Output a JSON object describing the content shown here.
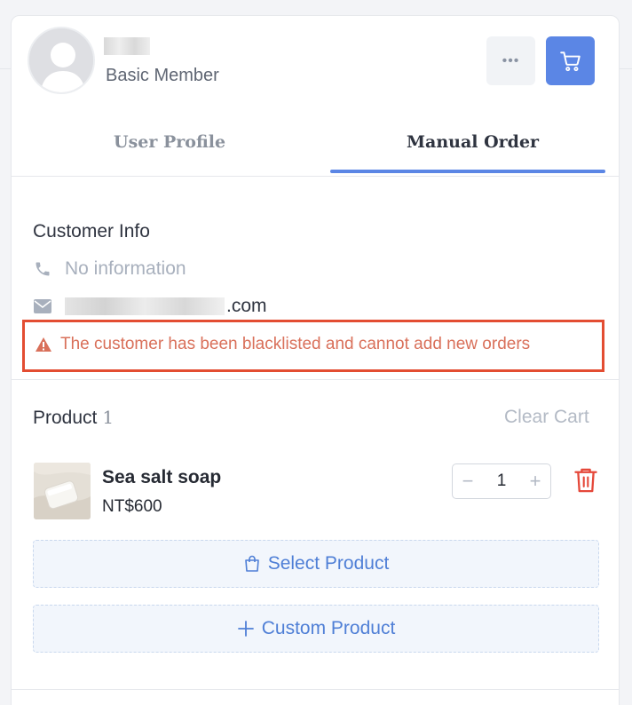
{
  "header": {
    "member_level": "Basic Member",
    "more_label": "•••"
  },
  "tabs": [
    {
      "label": "User Profile",
      "active": false
    },
    {
      "label": "Manual Order",
      "active": true
    }
  ],
  "customer": {
    "title": "Customer Info",
    "phone": "No information",
    "email_suffix": ".com",
    "warning": "The customer has been blacklisted and cannot add new orders"
  },
  "product": {
    "title": "Product",
    "count": "1",
    "clear_cart": "Clear Cart",
    "items": [
      {
        "name": "Sea salt soap",
        "price": "NT$600",
        "qty": "1"
      }
    ],
    "select_label": "Select Product",
    "custom_label": "Custom Product"
  },
  "colors": {
    "accent": "#5b86e5",
    "warning": "#e34d32",
    "delete": "#e5483a"
  },
  "icons": [
    "user-avatar-icon",
    "more-icon",
    "cart-icon",
    "phone-icon",
    "mail-icon",
    "warning-icon",
    "trash-icon",
    "shopping-bag-icon",
    "plus-icon"
  ]
}
